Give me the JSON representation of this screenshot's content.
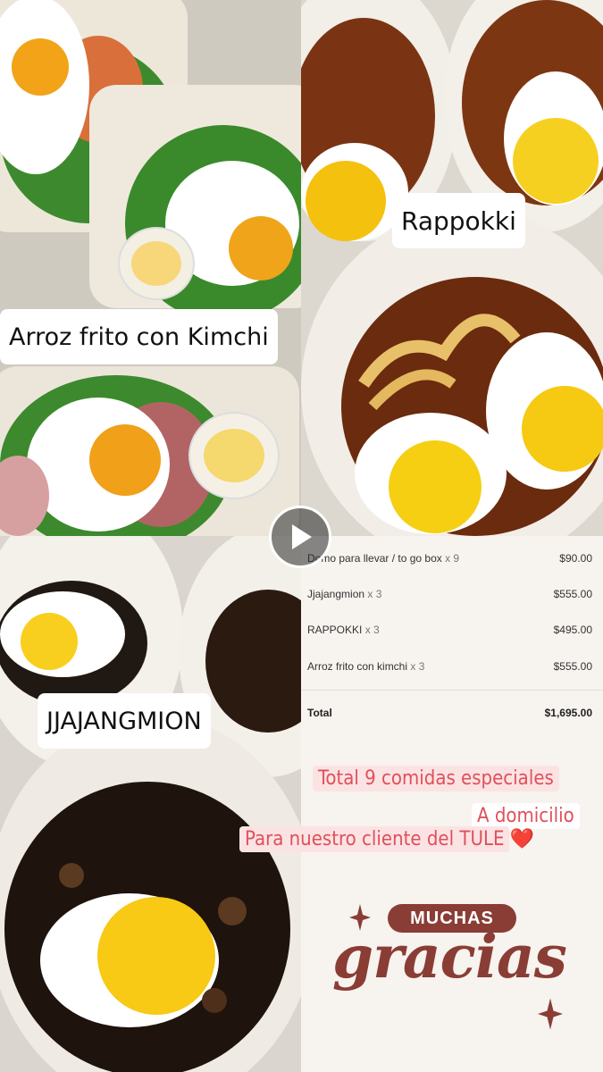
{
  "labels": {
    "arroz": "Arroz frito con Kimchi",
    "rappokki": "Rappokki",
    "jjajangmion": "JJAJANGMION"
  },
  "receipt": {
    "items": [
      {
        "name": "Domo para llevar / to go box",
        "qty": "x 9",
        "price": "$90.00"
      },
      {
        "name": "Jjajangmion",
        "qty": "x 3",
        "price": "$555.00"
      },
      {
        "name": "RAPPOKKI",
        "qty": "x 3",
        "price": "$495.00"
      },
      {
        "name": "Arroz frito con kimchi",
        "qty": "x 3",
        "price": "$555.00"
      }
    ],
    "total_label": "Total",
    "total_value": "$1,695.00"
  },
  "promo": {
    "line1": "Total 9 comidas especiales",
    "line2": "A domicilio",
    "line3": "Para nuestro cliente del TULE",
    "heart": "❤️"
  },
  "thanks": {
    "pill": "MUCHAS",
    "script": "gracias"
  },
  "icons": {
    "play": "play-icon",
    "sparkle": "sparkle-icon"
  },
  "colors": {
    "brand_brown": "#8a3d35",
    "promo_red": "#e0505a"
  }
}
